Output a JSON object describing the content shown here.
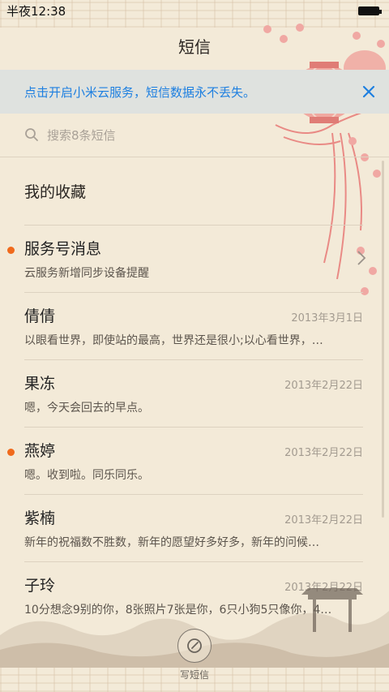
{
  "status_bar": {
    "time": "半夜12:38",
    "battery_icon": "battery-full-icon"
  },
  "header": {
    "title": "短信"
  },
  "banner": {
    "text": "点击开启小米云服务，短信数据永不丢失。",
    "close_icon": "close-icon",
    "color": "#1d7fe0"
  },
  "search": {
    "placeholder": "搜索8条短信",
    "icon": "search-icon"
  },
  "favorites": {
    "label": "我的收藏"
  },
  "conversations": [
    {
      "name": "服务号消息",
      "date": "",
      "snippet": "云服务新增同步设备提醒",
      "unread": true,
      "has_chevron": true
    },
    {
      "name": "倩倩",
      "date": "2013年3月1日",
      "snippet": "以眼看世界，即使站的最高，世界还是很小;以心看世界，…",
      "unread": false
    },
    {
      "name": "果冻",
      "date": "2013年2月22日",
      "snippet": "嗯，今天会回去的早点。",
      "unread": false
    },
    {
      "name": "燕婷",
      "date": "2013年2月22日",
      "snippet": "嗯。收到啦。同乐同乐。",
      "unread": true
    },
    {
      "name": "紫楠",
      "date": "2013年2月22日",
      "snippet": "新年的祝福数不胜数，新年的愿望好多好多，新年的问候…",
      "unread": false
    },
    {
      "name": "子玲",
      "date": "2013年2月22日",
      "snippet": "10分想念9别的你，8张照片7张是你，6只小狗5只像你，4…",
      "unread": false
    }
  ],
  "compose": {
    "label": "写短信",
    "icon": "compose-icon"
  },
  "colors": {
    "background": "#f3ead8",
    "unread_dot": "#f06a1c",
    "lantern": "#e98a85"
  }
}
